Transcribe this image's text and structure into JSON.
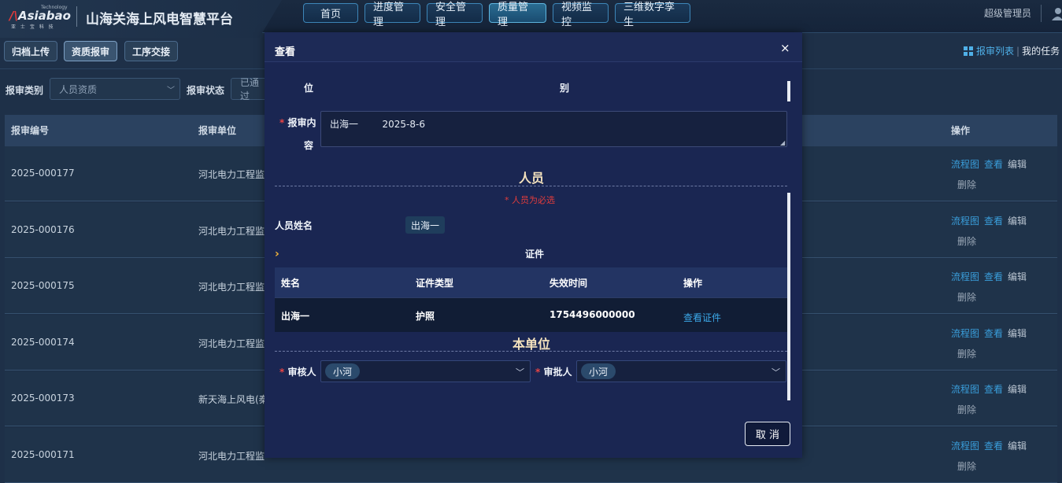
{
  "header": {
    "logo_small": "Technology",
    "logo_text": "Asiabao",
    "logo_sub": "亚 士 宝 科 技",
    "app_title": "山海关海上风电智慧平台",
    "nav": [
      "首页",
      "进度管理",
      "安全管理",
      "质量管理",
      "视频监控",
      "三维数字孪生"
    ],
    "active_nav": "质量管理",
    "user": "超级管理员"
  },
  "subbar": {
    "buttons": [
      "归档上传",
      "资质报审",
      "工序交接"
    ],
    "active": "资质报审",
    "link_list": "报审列表",
    "link_tasks": "我的任务"
  },
  "filters": {
    "type_label": "报审类别",
    "type_value": "人员资质",
    "status_label": "报审状态",
    "status_value": "已通过"
  },
  "table": {
    "headers": [
      "报审编号",
      "报审单位",
      "操作"
    ],
    "actions": {
      "flow": "流程图",
      "view": "查看",
      "edit": "编辑",
      "delete": "删除"
    },
    "rows": [
      {
        "id": "2025-000177",
        "unit": "河北电力工程监"
      },
      {
        "id": "2025-000176",
        "unit": "河北电力工程监"
      },
      {
        "id": "2025-000175",
        "unit": "河北电力工程监"
      },
      {
        "id": "2025-000174",
        "unit": "河北电力工程监"
      },
      {
        "id": "2025-000173",
        "unit": "新天海上风电(秦"
      },
      {
        "id": "2025-000171",
        "unit": "河北电力工程监"
      }
    ]
  },
  "modal": {
    "title": "查看",
    "close": "×",
    "top_left": "位",
    "top_mid": "别",
    "content_label_1": "报审内",
    "content_label_2": "容",
    "required_mark": "*",
    "content_value": "出海一        2025-8-6",
    "section_person": "人员",
    "person_required": "* 人员为必选",
    "person_name_label": "人员姓名",
    "person_name": "出海一",
    "cert_title": "证件",
    "cert_headers": [
      "姓名",
      "证件类型",
      "失效时间",
      "操作"
    ],
    "cert_row": {
      "name": "出海一",
      "type": "护照",
      "expire": "1754496000000",
      "action": "查看证件"
    },
    "section_unit": "本单位",
    "reviewer_label": "审核人",
    "reviewer": "小河",
    "approver_label": "审批人",
    "approver": "小河",
    "cancel": "取 消"
  }
}
